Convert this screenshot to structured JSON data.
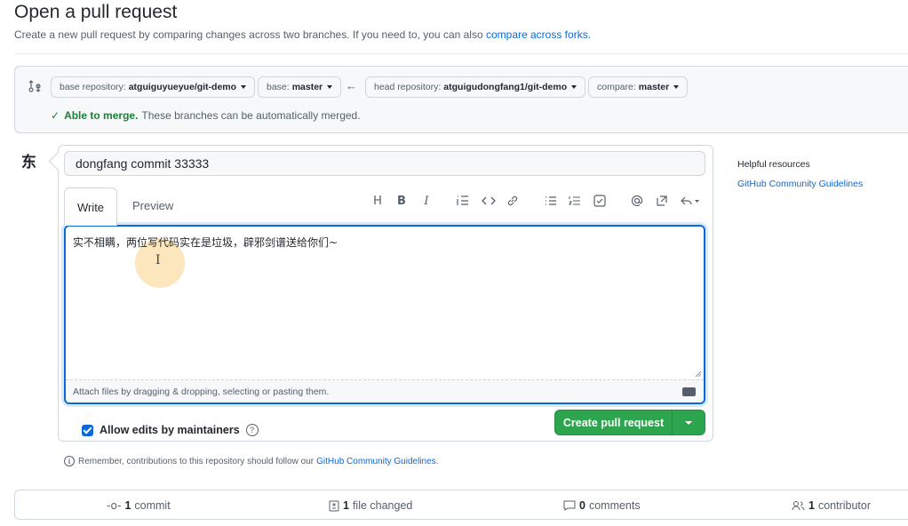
{
  "page": {
    "title": "Open a pull request",
    "subtitle": "Create a new pull request by comparing changes across two branches. If you need to, you can also ",
    "subtitle_link": "compare across forks."
  },
  "compare": {
    "base_repo_label": "base repository:",
    "base_repo_value": "atguiguyueyue/git-demo",
    "base_label": "base:",
    "base_value": "master",
    "head_repo_label": "head repository:",
    "head_repo_value": "atguigudongfang1/git-demo",
    "compare_label": "compare:",
    "compare_value": "master",
    "merge_ok": "Able to merge.",
    "merge_text": "These branches can be automatically merged."
  },
  "author": {
    "avatar_text": "东"
  },
  "form": {
    "title_value": "dongfang commit 33333",
    "tab_write": "Write",
    "tab_preview": "Preview",
    "body_text": "实不相瞒，两位写代码实在是垃圾，辟邪剑谱送给你们~",
    "attach_hint": "Attach files by dragging & dropping, selecting or pasting them.",
    "allow_edits": "Allow edits by maintainers",
    "create_button": "Create pull request"
  },
  "toolbar": {
    "heading": "H",
    "bold": "B",
    "italic": "I"
  },
  "remember": {
    "text": "Remember, contributions to this repository should follow our",
    "link": "GitHub Community Guidelines."
  },
  "sidebar": {
    "heading": "Helpful resources",
    "link": "GitHub Community Guidelines"
  },
  "stats": {
    "commits_count": "1",
    "commits_label": "commit",
    "files_count": "1",
    "files_label": "file changed",
    "comments_count": "0",
    "comments_label": "comments",
    "contributors_count": "1",
    "contributors_label": "contributor"
  },
  "colors": {
    "accent": "#0969da",
    "success": "#2da44e",
    "border": "#d0d7de"
  }
}
